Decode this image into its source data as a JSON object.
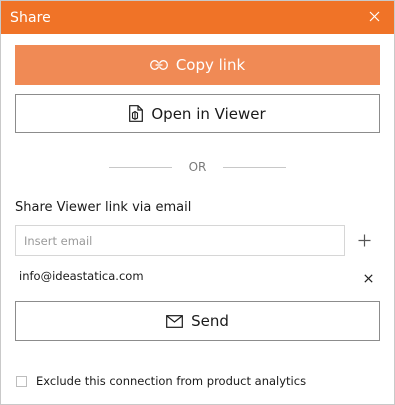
{
  "dialog": {
    "title": "Share",
    "close_icon": "close-icon"
  },
  "copy_button": {
    "label": "Copy link",
    "icon": "link-icon"
  },
  "open_button": {
    "label": "Open in Viewer",
    "icon": "viewer-document-icon"
  },
  "divider": {
    "label": "OR"
  },
  "email_section": {
    "label": "Share Viewer link via email",
    "input_placeholder": "Insert email",
    "input_value": "",
    "add_icon": "plus-icon",
    "recipients": [
      {
        "email": "info@ideastatica.com",
        "remove_icon": "close-icon"
      }
    ]
  },
  "send_button": {
    "label": "Send",
    "icon": "envelope-icon"
  },
  "exclude_option": {
    "label": "Exclude this connection from product analytics",
    "checked": false
  },
  "colors": {
    "title_bar": "#f07327",
    "primary_button": "#f08a55",
    "border": "#8c8c8c"
  }
}
